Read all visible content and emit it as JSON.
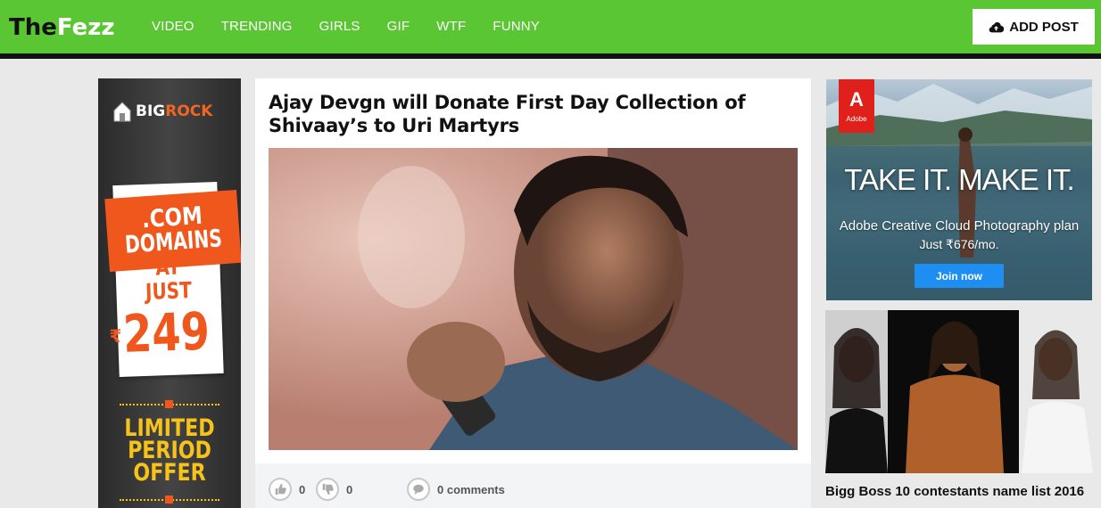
{
  "header": {
    "logo_part1": "The",
    "logo_part2": "Fezz",
    "nav": [
      "VIDEO",
      "TRENDING",
      "GIRLS",
      "GIF",
      "WTF",
      "FUNNY"
    ],
    "add_post_label": "ADD POST",
    "brand_color": "#5ac634"
  },
  "left_ad": {
    "brand_part1": "BIG",
    "brand_part2": "ROCK",
    "ribbon_line1": ".COM",
    "ribbon_line2": "DOMAINS",
    "at_just_line1": "AT",
    "at_just_line2": "JUST",
    "currency": "₹",
    "price": "249",
    "offer_line1": "LIMITED",
    "offer_line2": "PERIOD",
    "offer_line3": "OFFER"
  },
  "article": {
    "title": "Ajay Devgn will Donate First Day Collection of Shivaay’s to Uri Martyrs",
    "likes": "0",
    "dislikes": "0",
    "comments": "0 comments"
  },
  "adobe_ad": {
    "logo_text": "Adobe",
    "headline": "TAKE IT. MAKE IT.",
    "plan": "Adobe Creative Cloud Photography plan",
    "price": "Just ₹676/mo.",
    "cta": "Join now"
  },
  "side_post": {
    "title": "Bigg Boss 10 contestants name list 2016"
  }
}
